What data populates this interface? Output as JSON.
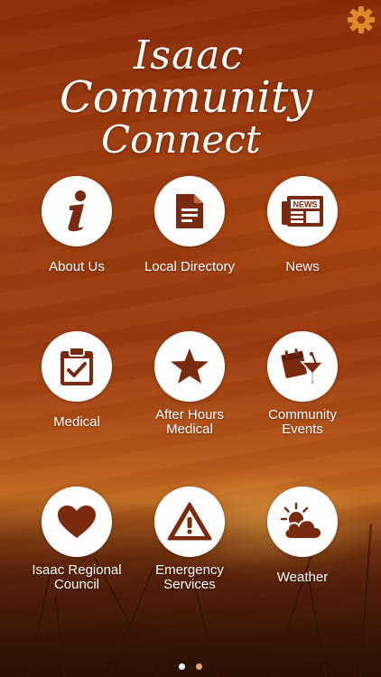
{
  "app": {
    "title_line1": "Isaac",
    "title_line2": "Community",
    "title_line3": "Connect",
    "settings_icon": "gear-icon",
    "accent": "#e08a2c",
    "icon_color": "#7a2a0e"
  },
  "menu": [
    {
      "label": "About Us",
      "icon": "info-icon"
    },
    {
      "label": "Local Directory",
      "icon": "document-icon"
    },
    {
      "label": "News",
      "icon": "newspaper-icon"
    },
    {
      "label": "Medical",
      "icon": "clipboard-check-icon"
    },
    {
      "label": "After Hours\nMedical",
      "icon": "star-icon"
    },
    {
      "label": "Community\nEvents",
      "icon": "calendar-cocktail-icon"
    },
    {
      "label": "Isaac Regional\nCouncil",
      "icon": "heart-icon"
    },
    {
      "label": "Emergency\nServices",
      "icon": "warning-icon"
    },
    {
      "label": "Weather",
      "icon": "sun-cloud-icon"
    }
  ],
  "pager": {
    "pages": 2,
    "current": 1,
    "active_color": "#ffffff",
    "inactive_color": "#e8a070"
  }
}
